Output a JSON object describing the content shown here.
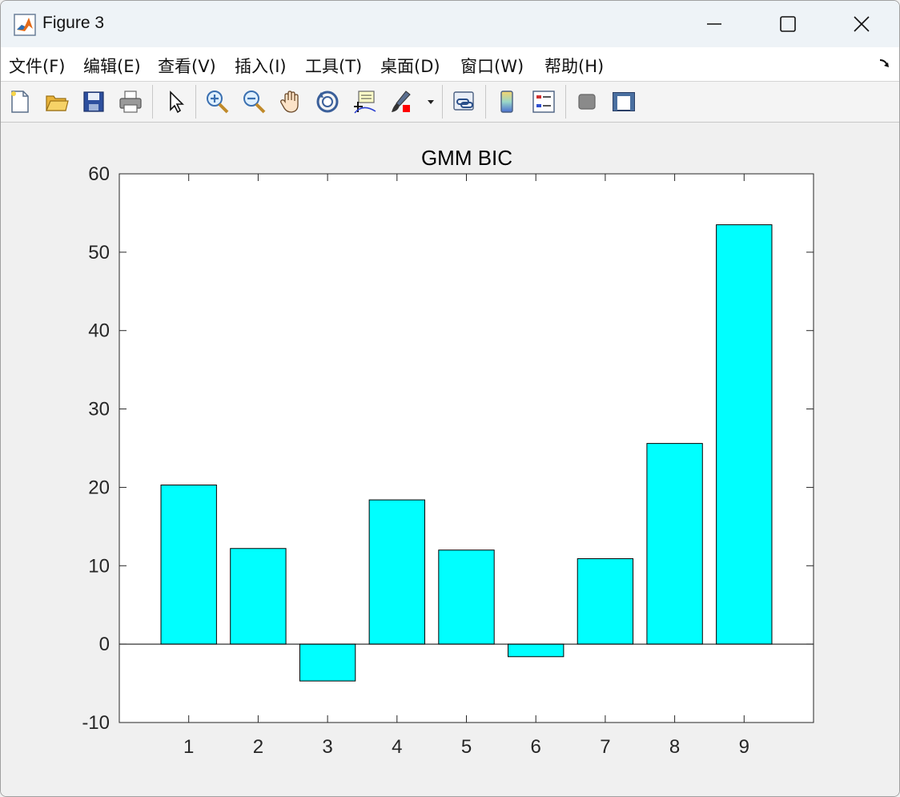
{
  "window": {
    "title": "Figure 3"
  },
  "menu": {
    "items": [
      {
        "label": "文件(F)",
        "name": "menu-file"
      },
      {
        "label": "编辑(E)",
        "name": "menu-edit"
      },
      {
        "label": "查看(V)",
        "name": "menu-view"
      },
      {
        "label": "插入(I)",
        "name": "menu-insert"
      },
      {
        "label": "工具(T)",
        "name": "menu-tools"
      },
      {
        "label": "桌面(D)",
        "name": "menu-desktop"
      },
      {
        "label": "窗口(W)",
        "name": "menu-window"
      },
      {
        "label": "帮助(H)",
        "name": "menu-help"
      }
    ]
  },
  "toolbar": {
    "icons": [
      "new-figure-icon",
      "open-file-icon",
      "save-icon",
      "print-icon",
      "pointer-icon",
      "zoom-in-icon",
      "zoom-out-icon",
      "pan-icon",
      "rotate-3d-icon",
      "data-cursor-icon",
      "brush-icon",
      "link-plot-icon",
      "colorbar-icon",
      "legend-icon",
      "hide-plot-tools-icon",
      "show-plot-tools-icon"
    ]
  },
  "colors": {
    "bar_fill": "#00ffff",
    "bar_edge": "#000000",
    "axes_bg": "#ffffff",
    "figure_bg": "#f0f0f0"
  },
  "chart_data": {
    "type": "bar",
    "title": "GMM BIC",
    "xlabel": "",
    "ylabel": "",
    "categories": [
      "1",
      "2",
      "3",
      "4",
      "5",
      "6",
      "7",
      "8",
      "9"
    ],
    "values": [
      20.3,
      12.2,
      -4.7,
      18.4,
      12.0,
      -1.6,
      10.9,
      25.6,
      53.5
    ],
    "ylim": [
      -10,
      60
    ],
    "yticks": [
      -10,
      0,
      10,
      20,
      30,
      40,
      50,
      60
    ],
    "grid": false
  }
}
